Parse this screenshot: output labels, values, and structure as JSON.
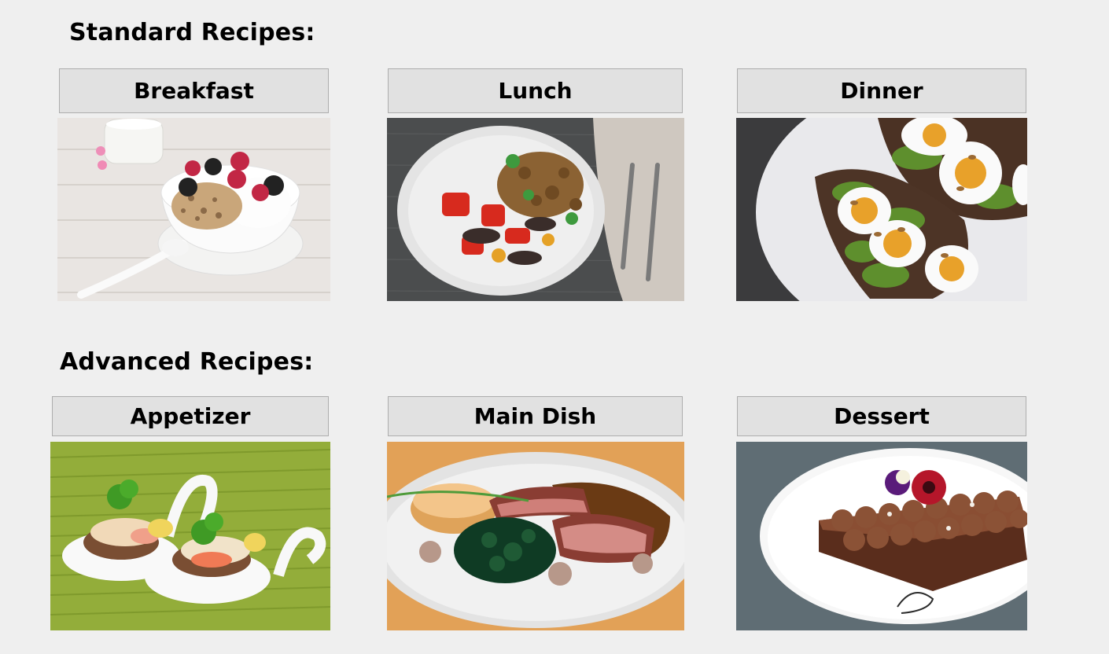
{
  "sections": {
    "standard": {
      "title": "Standard Recipes:",
      "buttons": {
        "breakfast": "Breakfast",
        "lunch": "Lunch",
        "dinner": "Dinner"
      }
    },
    "advanced": {
      "title": "Advanced Recipes:",
      "buttons": {
        "appetizer": "Appetizer",
        "main_dish": "Main Dish",
        "dessert": "Dessert"
      }
    }
  },
  "images": {
    "breakfast": "yogurt-bowl-with-berries-and-granola",
    "lunch": "plate-of-roasted-vegetables-with-fork-and-knife",
    "dinner": "avocado-toast-with-boiled-eggs",
    "appetizer": "canape-spoons-with-salmon-and-parsley",
    "main_dish": "sliced-beef-with-spinach-and-potato",
    "dessert": "chocolate-cake-slice-with-flowers"
  },
  "colors": {
    "window_background": "#efefef",
    "button_background": "#e1e1e1",
    "button_border": "#adadad"
  }
}
